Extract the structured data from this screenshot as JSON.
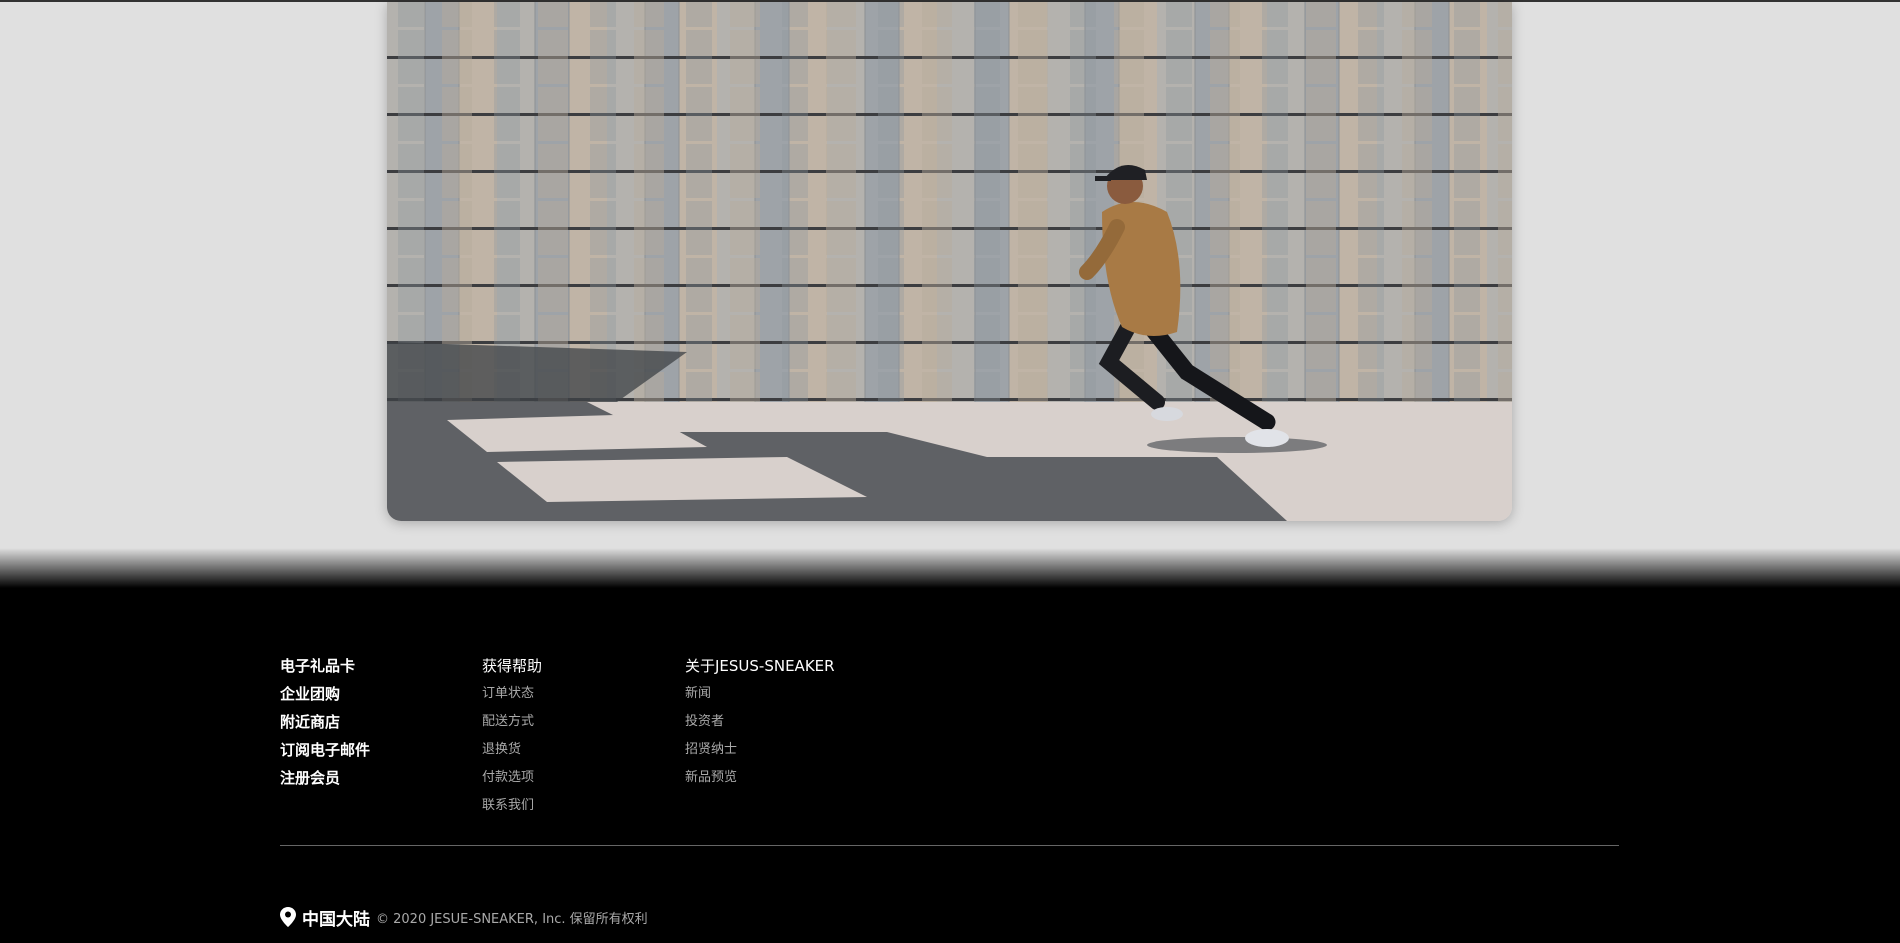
{
  "hero": {
    "image": "runner-in-tan-jacket-running-past-curved-stone-wall",
    "colors": {
      "wall": "#a7a9ab",
      "pavement": "#d9d3cf",
      "shadow": "#4a4d52",
      "jacket": "#a87a45"
    }
  },
  "footer": {
    "background": "#000000",
    "col1": {
      "items": [
        "电子礼品卡",
        "企业团购",
        "附近商店",
        "订阅电子邮件",
        "注册会员"
      ]
    },
    "col2": {
      "heading": "获得帮助",
      "links": [
        "订单状态",
        "配送方式",
        "退换货",
        "付款选项",
        "联系我们"
      ]
    },
    "col3": {
      "heading": "关于JESUS-SNEAKER",
      "links": [
        "新闻",
        "投资者",
        "招贤纳士",
        "新品预览"
      ]
    },
    "bottom": {
      "icon": "location-pin-icon",
      "region": "中国大陆",
      "copyright": "© 2020 JESUE-SNEAKER, Inc. 保留所有权利"
    }
  }
}
